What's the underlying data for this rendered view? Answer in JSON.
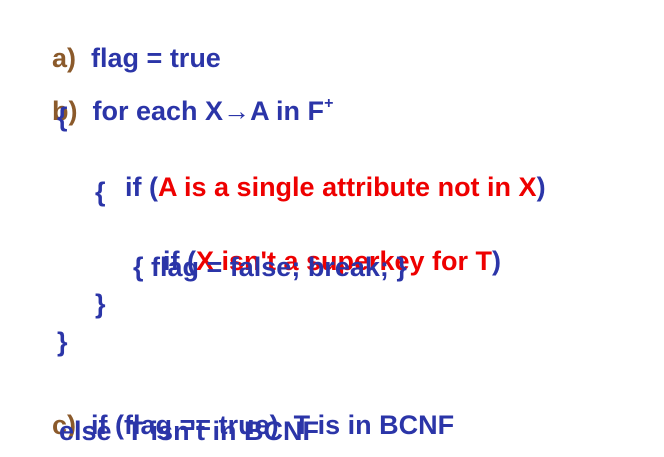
{
  "colors": {
    "text": "#2b35a8",
    "label": "#8b5a2b",
    "highlight": "#ee0000"
  },
  "lines": {
    "a": {
      "label": "a)",
      "code": "flag = true"
    },
    "b": {
      "label": "b)",
      "pre": "for each X",
      "arrow": "→",
      "post": "A in F",
      "sup": "+"
    },
    "brace_open_outer": "{",
    "if1": {
      "pre": "if (",
      "cond": "A is a single attribute not in X",
      "post": ")"
    },
    "brace_open_inner": "{",
    "if2": {
      "pre": "if (",
      "cond": "X isn't a superkey for T",
      "post": ")"
    },
    "action": "{ flag = false; break; }",
    "brace_close_inner": "}",
    "brace_close_outer": "}",
    "c": {
      "label": "c)",
      "code": "if (flag == true)  T is in BCNF"
    },
    "else": "else  T isn't in BCNF"
  }
}
